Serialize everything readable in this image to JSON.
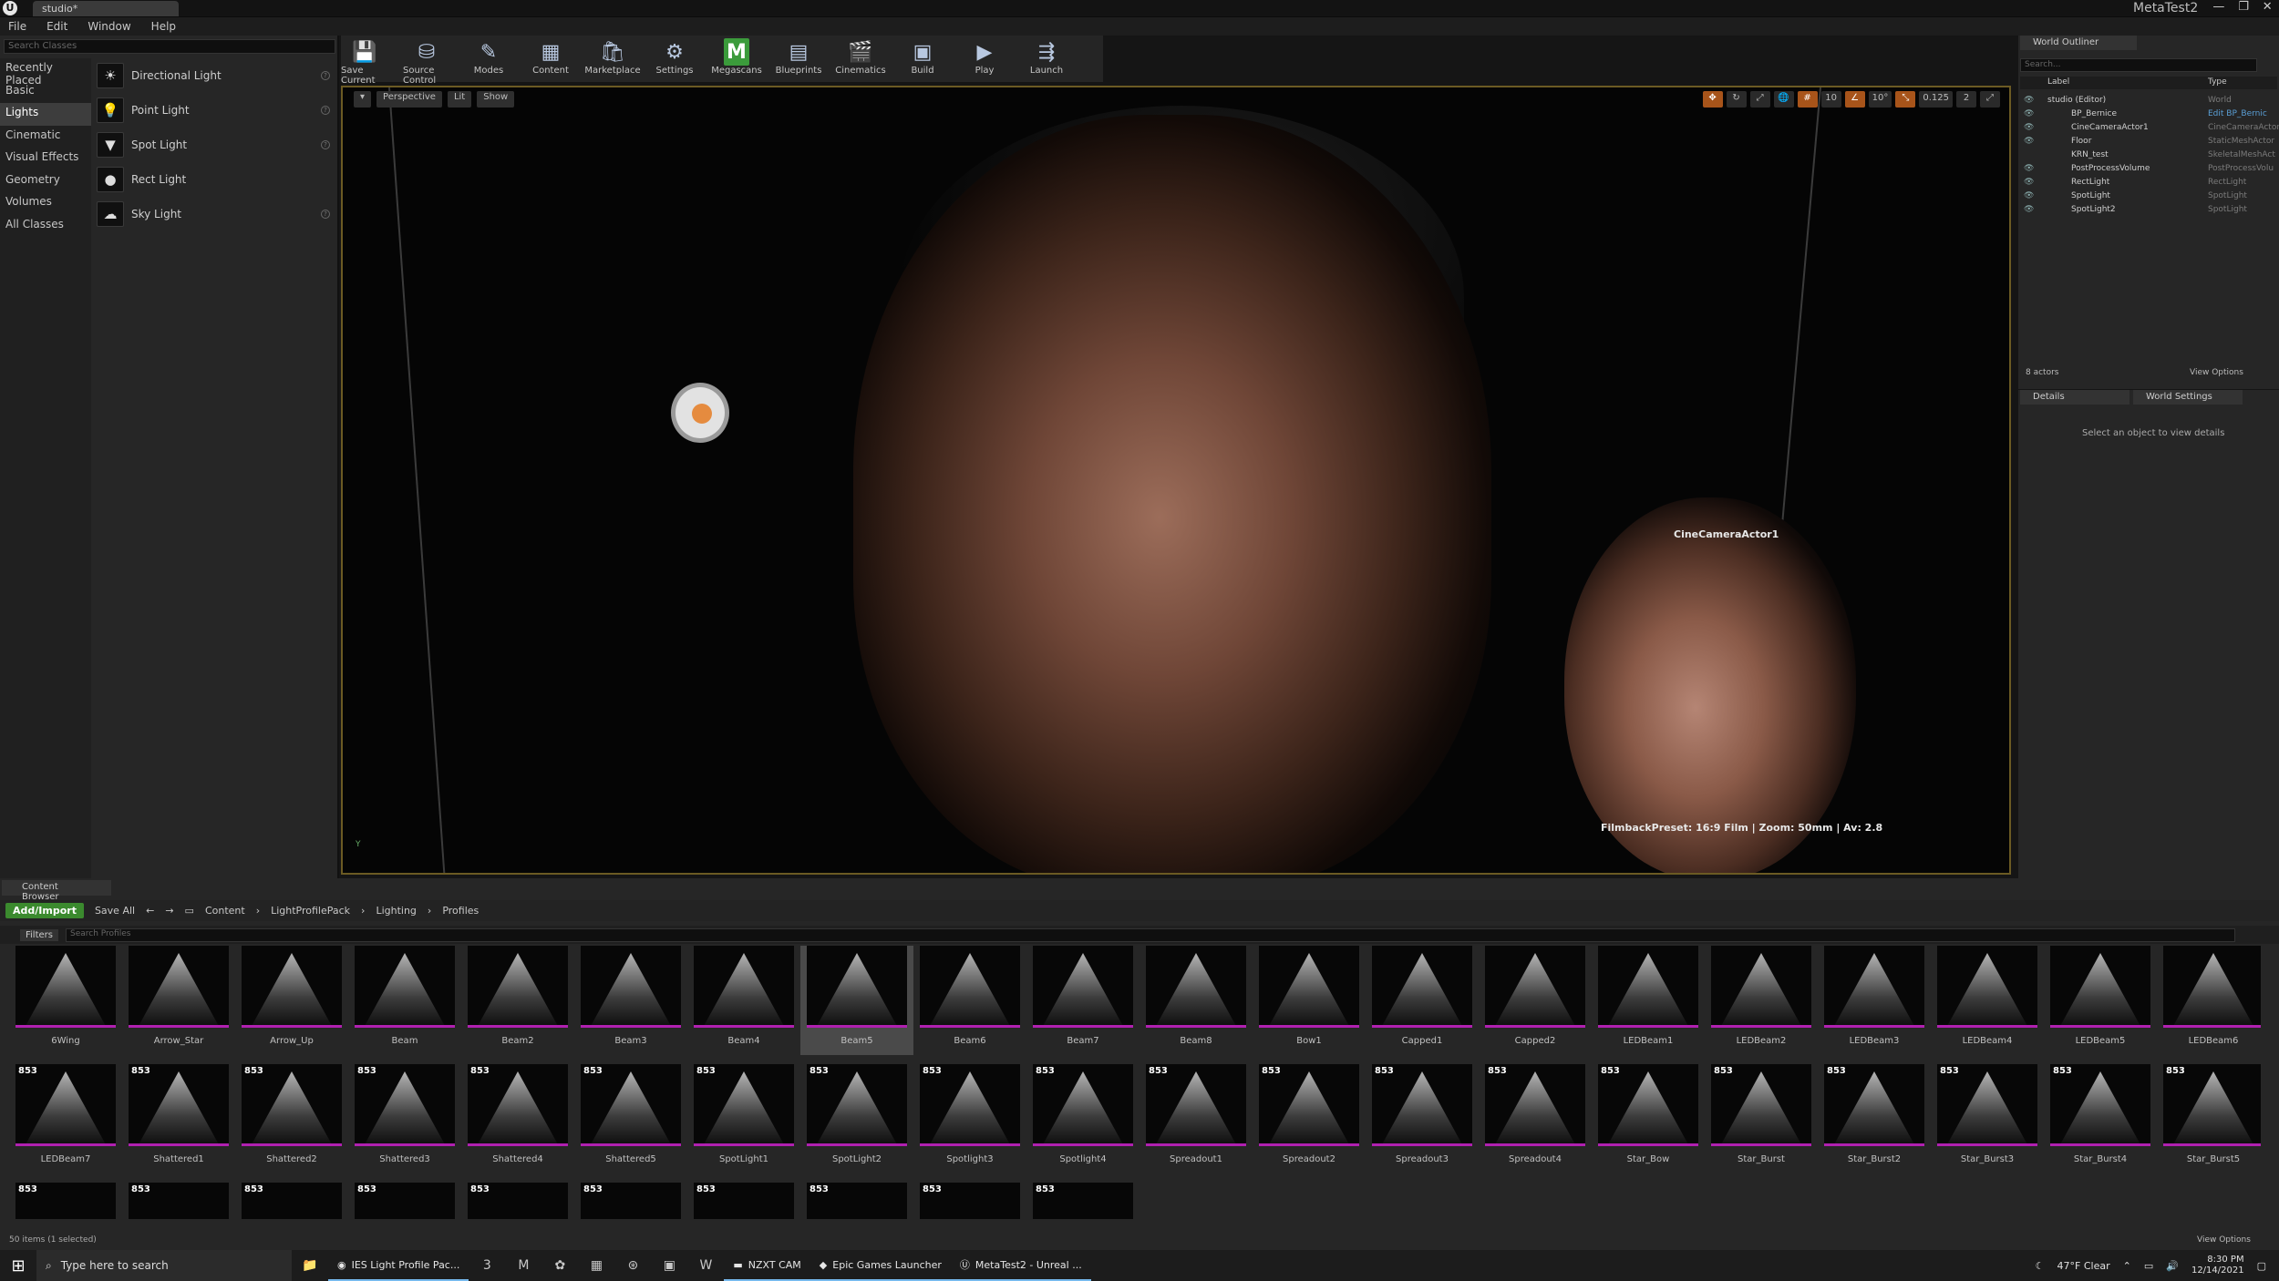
{
  "window": {
    "doc_tab": "studio*",
    "app_title": "MetaTest2",
    "ue_logo": "U",
    "controls": [
      "—",
      "❐",
      "✕"
    ]
  },
  "menu": [
    "File",
    "Edit",
    "Window",
    "Help"
  ],
  "place_panel": {
    "search_placeholder": "Search Classes",
    "categories": [
      "Recently Placed",
      "Basic",
      "Lights",
      "Cinematic",
      "Visual Effects",
      "Geometry",
      "Volumes",
      "All Classes"
    ],
    "selected_category": "Lights",
    "items": [
      "Directional Light",
      "Point Light",
      "Spot Light",
      "Rect Light",
      "Sky Light"
    ]
  },
  "toolbar": [
    "Save Current",
    "Source Control",
    "Modes",
    "Content",
    "Marketplace",
    "Settings",
    "Megascans",
    "Blueprints",
    "Cinematics",
    "Build",
    "Play",
    "Launch"
  ],
  "viewport": {
    "buttons": [
      "Perspective",
      "Lit",
      "Show"
    ],
    "right_controls": [
      "10",
      "10°",
      "0.125",
      "2"
    ],
    "camera_label": "CineCameraActor1",
    "filmback": "FilmbackPreset: 16:9 Film | Zoom: 50mm | Av: 2.8",
    "axis": "Y"
  },
  "outliner": {
    "tab": "World Outliner",
    "search_placeholder": "Search...",
    "col_label": "Label",
    "col_type": "Type",
    "rows": [
      {
        "label": "studio (Editor)",
        "type": "World"
      },
      {
        "label": "BP_Bernice",
        "type": "Edit BP_Bernic"
      },
      {
        "label": "CineCameraActor1",
        "type": "CineCameraActor"
      },
      {
        "label": "Floor",
        "type": "StaticMeshActor"
      },
      {
        "label": "KRN_test",
        "type": "SkeletalMeshAct"
      },
      {
        "label": "PostProcessVolume",
        "type": "PostProcessVolu"
      },
      {
        "label": "RectLight",
        "type": "RectLight"
      },
      {
        "label": "SpotLight",
        "type": "SpotLight"
      },
      {
        "label": "SpotLight2",
        "type": "SpotLight"
      }
    ],
    "actor_count": "8 actors",
    "view_options": "View Options"
  },
  "details": {
    "tabs": [
      "Details",
      "World Settings"
    ],
    "message": "Select an object to view details"
  },
  "content_browser": {
    "tab": "Content Browser",
    "add_import": "Add/Import",
    "save_all": "Save All",
    "path": [
      "Content",
      "LightProfilePack",
      "Lighting",
      "Profiles"
    ],
    "filters": "Filters",
    "search_placeholder": "Search Profiles",
    "badge": "853",
    "assets": [
      "6Wing",
      "Arrow_Star",
      "Arrow_Up",
      "Beam",
      "Beam2",
      "Beam3",
      "Beam4",
      "Beam5",
      "Beam6",
      "Beam7",
      "Beam8",
      "Bow1",
      "Capped1",
      "Capped2",
      "LEDBeam1",
      "LEDBeam2",
      "LEDBeam3",
      "LEDBeam4",
      "LEDBeam5",
      "LEDBeam6",
      "LEDBeam7",
      "Shattered1",
      "Shattered2",
      "Shattered3",
      "Shattered4",
      "Shattered5",
      "SpotLight1",
      "SpotLight2",
      "Spotlight3",
      "Spotlight4",
      "Spreadout1",
      "Spreadout2",
      "Spreadout3",
      "Spreadout4",
      "Star_Bow",
      "Star_Burst",
      "Star_Burst2",
      "Star_Burst3",
      "Star_Burst4",
      "Star_Burst5"
    ],
    "selected": "Beam5",
    "status": "50 items (1 selected)",
    "view_options": "View Options"
  },
  "taskbar": {
    "search": "Type here to search",
    "apps": [
      "IES Light Profile Pac...",
      "NZXT CAM",
      "Epic Games Launcher",
      "MetaTest2 - Unreal ..."
    ],
    "weather": "47°F  Clear",
    "time": "8:30 PM",
    "date": "12/14/2021"
  }
}
